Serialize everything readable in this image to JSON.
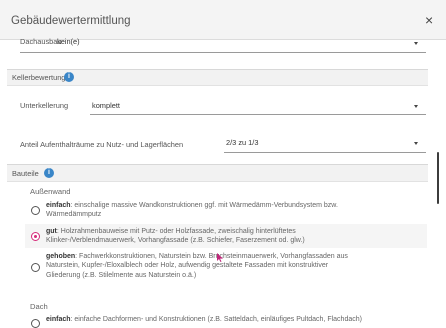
{
  "dialog": {
    "title": "Gebäudewertermittlung",
    "close_icon": "×"
  },
  "dachausbau": {
    "label": "Dachausbau",
    "value": "kein(e)"
  },
  "kellerbewertung": {
    "title": "Kellerbewertung",
    "info_icon": "i",
    "unterkellerung": {
      "label": "Unterkellerung",
      "value": "komplett"
    },
    "anteil": {
      "label": "Anteil Aufenthalträume zu Nutz- und Lagerflächen",
      "value": "2/3 zu 1/3"
    }
  },
  "bauteile": {
    "title": "Bauteile",
    "info_icon": "i",
    "aussenwand": {
      "label": "Außenwand",
      "options": [
        {
          "bold": "einfach",
          "text": ": einschalige massive Wandkonstruktionen ggf. mit Wärmedämm-Verbundsystem bzw.",
          "text2": "Wärmedämmputz",
          "selected": false
        },
        {
          "bold": "gut",
          "text": ": Holzrahmenbauweise mit Putz- oder Holzfassade, zweischalig hinterlüftetes",
          "text2": "Klinker-/Verblendmauerwerk, Vorhangfassade (z.B. Schiefer, Faserzement od. glw.)",
          "selected": true
        },
        {
          "bold": "gehoben",
          "text": ": Fachwerkkonstruktionen, Naturstein bzw. Bruchsteinmauerwerk, Vorhangfassaden aus",
          "text2": "Naturstein, Kupfer-/Eloxalblech oder Holz, aufwendig gestaltete Fassaden mit konstruktiver",
          "text3": "Gliederung (z.B. Stilelmente aus Naturstein o.ä.)",
          "selected": false
        }
      ]
    },
    "dach": {
      "label": "Dach",
      "options": [
        {
          "bold": "einfach",
          "text": ": einfache Dachformen- und Konstruktionen (z.B. Satteldach, einläufiges Pultdach, Flachdach)",
          "selected": false
        }
      ]
    }
  },
  "colors": {
    "accent": "#d62b7a",
    "info": "#3a86c8"
  }
}
